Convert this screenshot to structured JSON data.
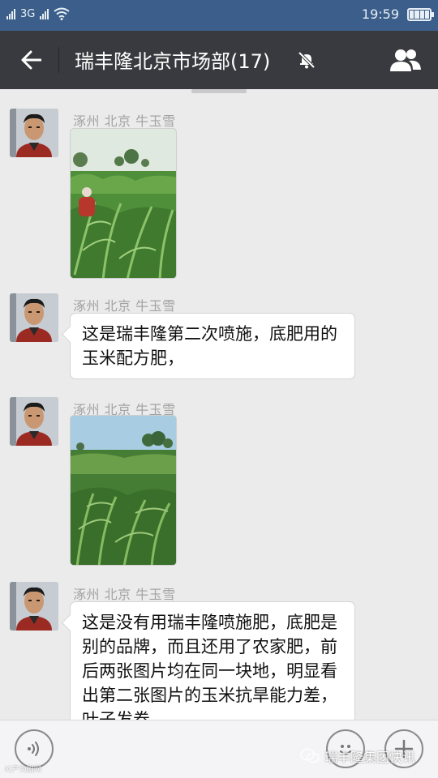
{
  "status_bar": {
    "network": "3G",
    "time": "19:59"
  },
  "header": {
    "title": "瑞丰隆北京市场部(17)",
    "back_icon": "back-arrow-icon",
    "mute_icon": "bell-muted-icon",
    "group_icon": "group-members-icon"
  },
  "messages": [
    {
      "type": "image",
      "sender": "涿州  北京 牛玉雪",
      "image": "young corn field with a worker"
    },
    {
      "type": "text",
      "sender": "涿州  北京 牛玉雪",
      "text": "这是瑞丰隆第二次喷施，底肥用的玉米配方肥，"
    },
    {
      "type": "image",
      "sender": "涿州  北京 牛玉雪",
      "image": "dense corn field under blue sky"
    },
    {
      "type": "text",
      "sender": "涿州  北京 牛玉雪",
      "text": "这是没有用瑞丰隆喷施肥，底肥是别的品牌，而且还用了农家肥，前后两张图片均在同一块地，明显看出第二张图片的玉米抗旱能力差，叶子发卷"
    }
  ],
  "input_bar": {
    "voice_icon": "voice-icon",
    "emoji_icon": "emoji-icon",
    "plus_icon": "plus-icon"
  },
  "watermark": {
    "text": "瑞丰隆集团快讯",
    "small_text": "iC产为剧网"
  },
  "colors": {
    "status_bar": "#3b5f8a",
    "title_bar": "#393a3f",
    "chat_background": "#ebebeb",
    "bubble": "#ffffff"
  }
}
